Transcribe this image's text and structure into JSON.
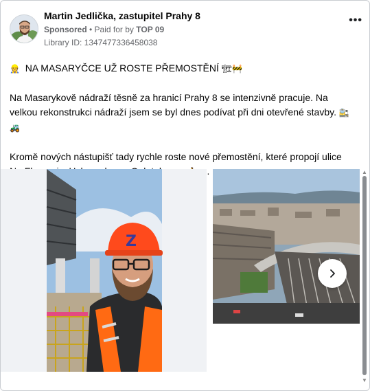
{
  "post": {
    "author": "Martin Jedlička, zastupitel Prahy 8",
    "sponsored": "Sponsored",
    "paid_prefix": " • Paid for by ",
    "paid_by": "TOP 09",
    "library_id": "Library ID: 1347477336458038",
    "more_label": "•••"
  },
  "text": {
    "headline": "NA MASARYČCE UŽ ROSTE PŘEMOSTĚNÍ",
    "paragraph1": "Na Masarykově nádraží těsně za hranicí Prahy 8 se intenzivně pracuje. Na velkou rekonstrukci nádraží jsem se byl dnes podívat při dni otevřené stavby.",
    "paragraph2": "Kromě nových nástupišť tady rychle roste nové přemostění, které propojí ulice Na Florenci s Hybernskou a Opletalovou.",
    "ellipsis": "…"
  },
  "icons": {
    "person": "construction-worker-icon",
    "site": "construction-site-icon",
    "barrier": "barrier-icon",
    "train": "train-icon",
    "tractor": "tractor-icon",
    "walker": "walking-person-icon",
    "next": "chevron-right-icon"
  },
  "colors": {
    "text": "#050505",
    "secondary": "#65676b",
    "helmet": "#ff4a1c",
    "vest": "#ff6a13"
  }
}
